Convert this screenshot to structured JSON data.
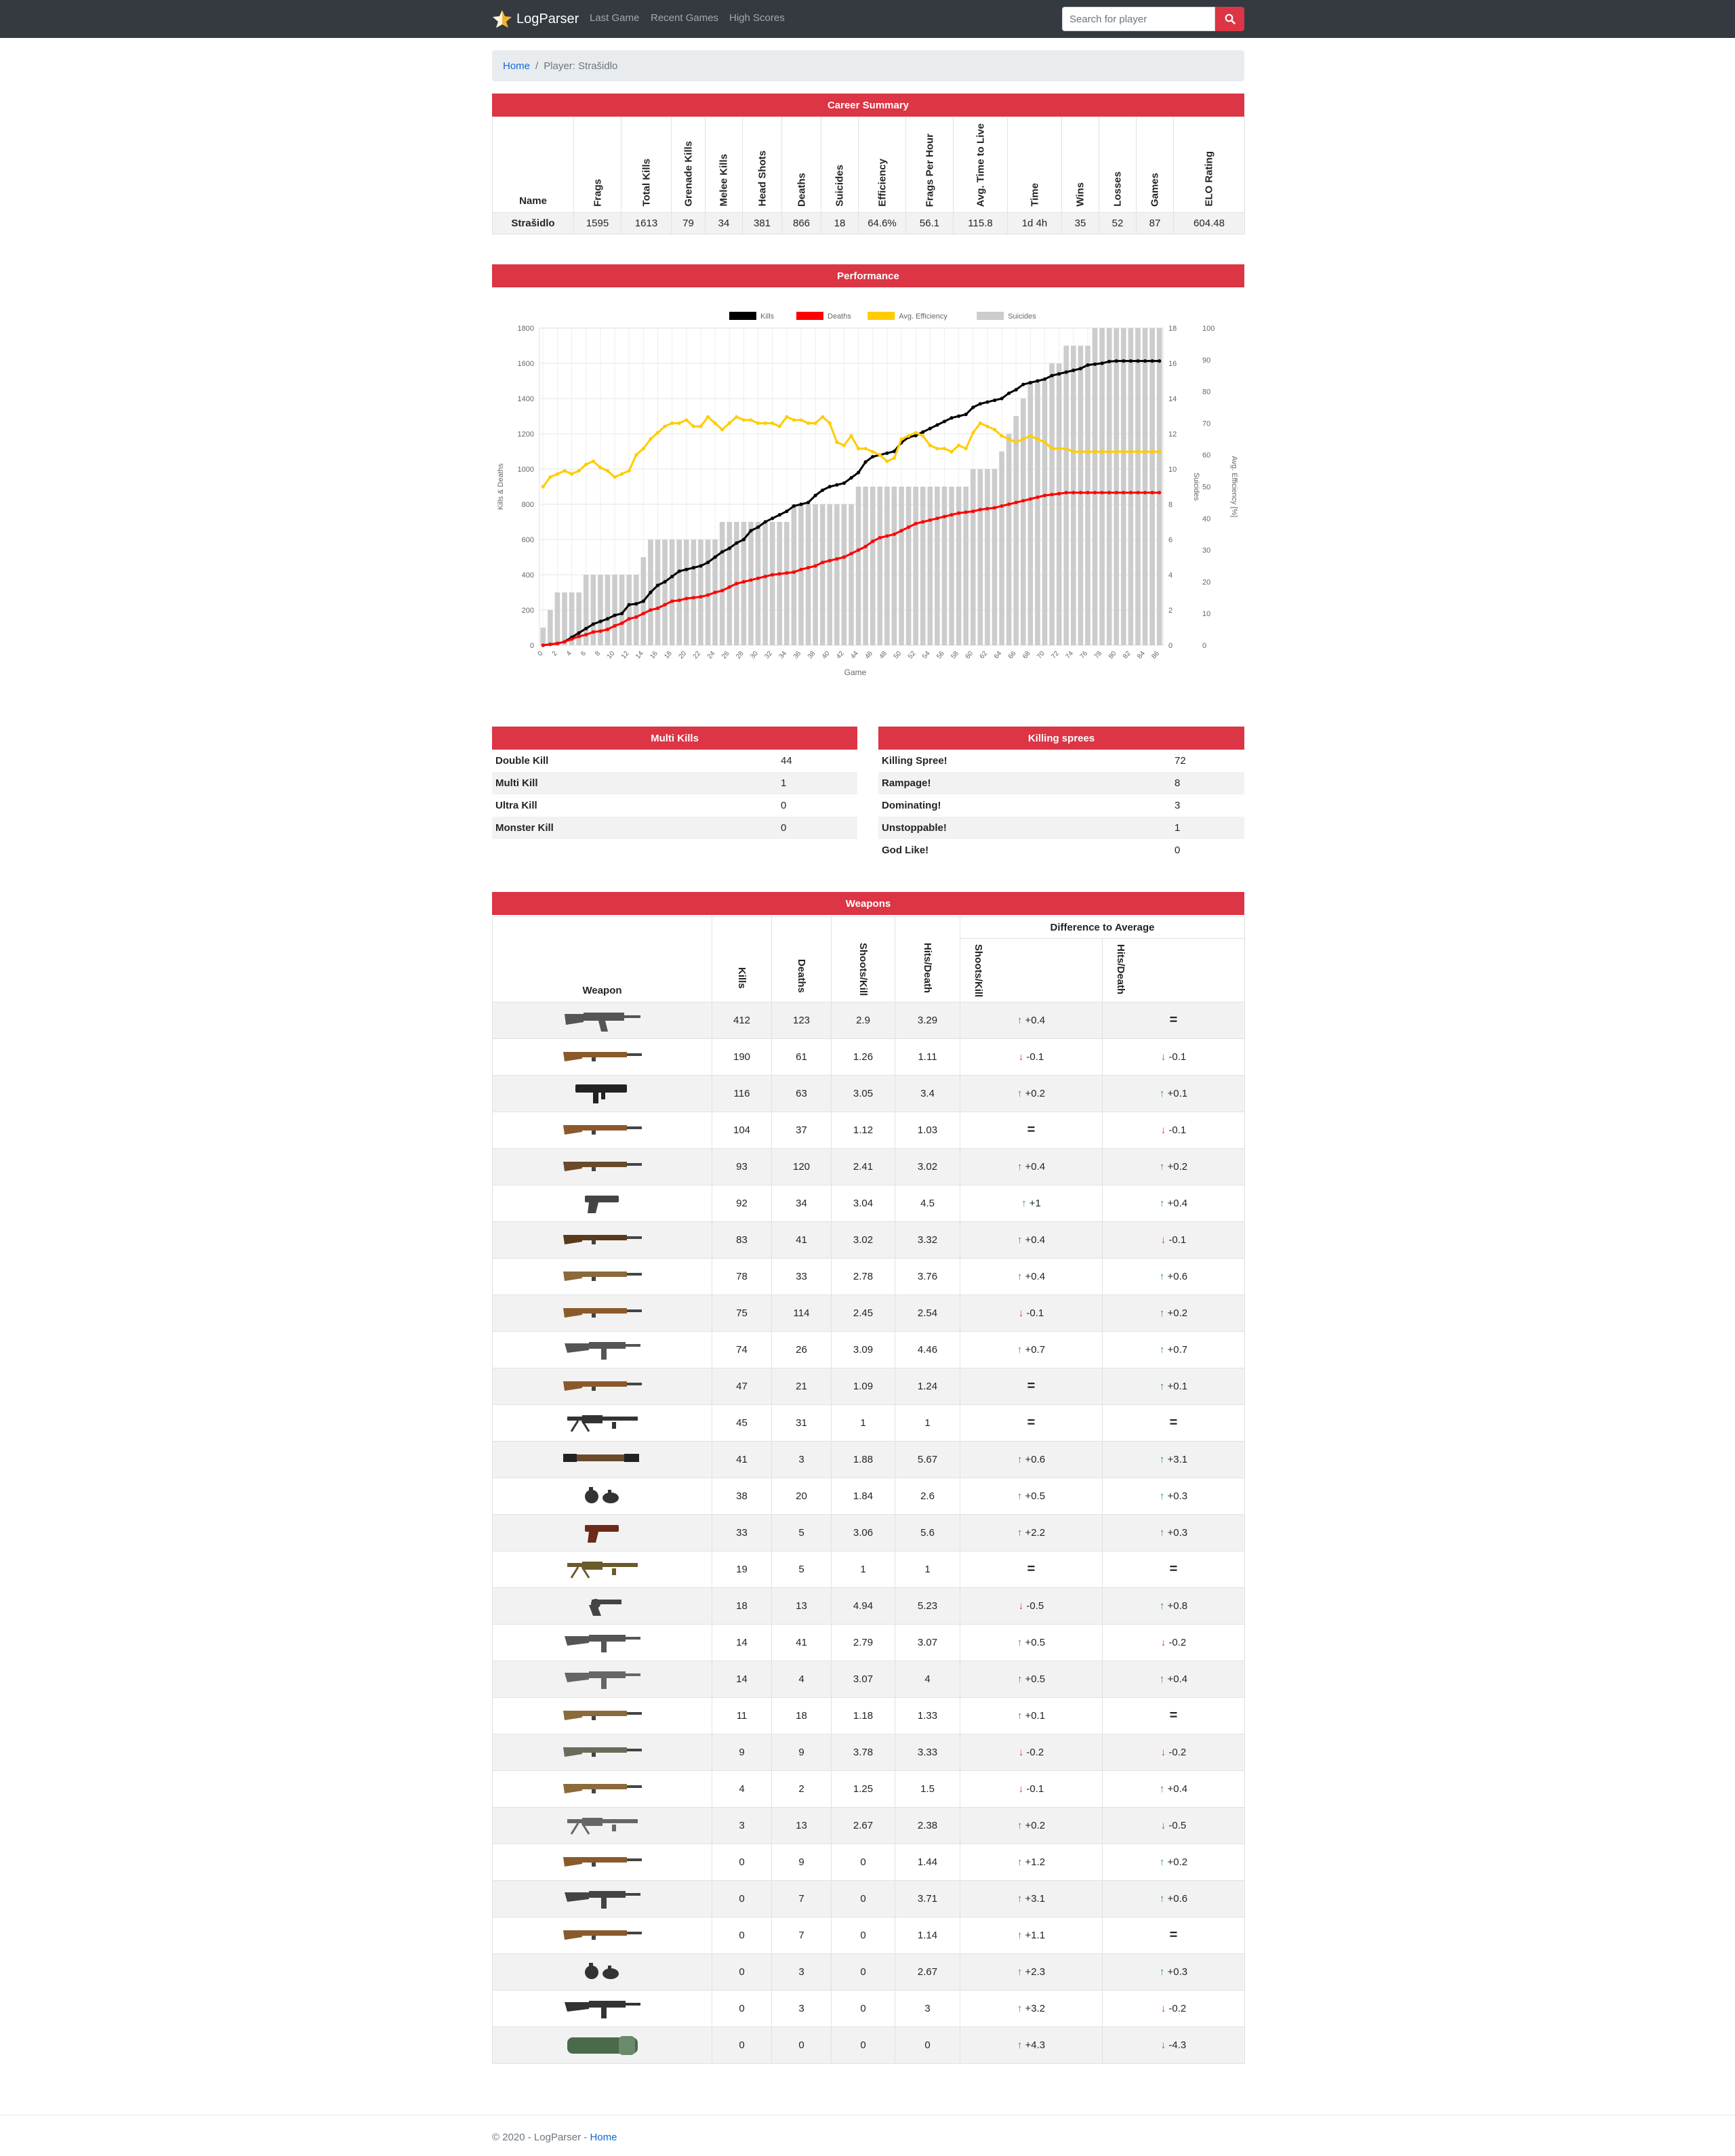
{
  "nav": {
    "brand": "LogParser",
    "links": [
      "Last Game",
      "Recent Games",
      "High Scores"
    ],
    "search_placeholder": "Search for player"
  },
  "breadcrumb": {
    "home": "Home",
    "current": "Player: Strašidlo"
  },
  "career": {
    "title": "Career Summary",
    "columns": [
      "Name",
      "Frags",
      "Total Kills",
      "Grenade Kills",
      "Melee Kills",
      "Head Shots",
      "Deaths",
      "Suicides",
      "Efficiency",
      "Frags Per Hour",
      "Avg. Time to Live",
      "Time",
      "Wins",
      "Losses",
      "Games",
      "ELO Rating"
    ],
    "row": [
      "Strašidlo",
      "1595",
      "1613",
      "79",
      "34",
      "381",
      "866",
      "18",
      "64.6%",
      "56.1",
      "115.8",
      "1d 4h",
      "35",
      "52",
      "87",
      "604.48"
    ]
  },
  "performance": {
    "title": "Performance"
  },
  "chart_data": {
    "type": "line",
    "xlabel": "Game",
    "ylabel": "Kills & Deaths",
    "y2label": "Suicides",
    "y3label": "Avg. Efficiency [%]",
    "ylim": [
      0,
      1800
    ],
    "y2lim": [
      0,
      18
    ],
    "y3lim": [
      0,
      100
    ],
    "yticks": [
      0,
      200,
      400,
      600,
      800,
      1000,
      1200,
      1400,
      1600,
      1800
    ],
    "y2ticks": [
      0,
      2,
      4,
      6,
      8,
      10,
      12,
      14,
      16,
      18
    ],
    "y3ticks": [
      0,
      10,
      20,
      30,
      40,
      50,
      60,
      70,
      80,
      90,
      100
    ],
    "xticks": [
      0,
      2,
      4,
      6,
      8,
      10,
      12,
      14,
      16,
      18,
      20,
      22,
      24,
      26,
      28,
      30,
      32,
      34,
      36,
      38,
      40,
      42,
      44,
      46,
      48,
      50,
      52,
      54,
      56,
      58,
      60,
      62,
      64,
      66,
      68,
      70,
      72,
      74,
      76,
      78,
      80,
      82,
      84,
      86
    ],
    "legend": "top",
    "series": [
      {
        "name": "Kills",
        "color": "#000000",
        "axis": "left",
        "values": [
          0,
          5,
          10,
          20,
          45,
          70,
          95,
          120,
          135,
          150,
          170,
          180,
          230,
          235,
          250,
          300,
          340,
          360,
          390,
          420,
          430,
          440,
          450,
          470,
          500,
          530,
          550,
          580,
          600,
          650,
          670,
          700,
          720,
          740,
          760,
          790,
          800,
          810,
          850,
          880,
          900,
          910,
          920,
          950,
          980,
          1040,
          1070,
          1080,
          1090,
          1100,
          1150,
          1180,
          1190,
          1210,
          1230,
          1250,
          1270,
          1290,
          1300,
          1310,
          1350,
          1370,
          1380,
          1390,
          1400,
          1430,
          1450,
          1480,
          1490,
          1500,
          1510,
          1530,
          1540,
          1550,
          1560,
          1570,
          1590,
          1595,
          1600,
          1610,
          1613,
          1613,
          1613,
          1613,
          1613,
          1613,
          1613
        ]
      },
      {
        "name": "Deaths",
        "color": "#ff0000",
        "axis": "left",
        "values": [
          0,
          5,
          10,
          20,
          35,
          50,
          60,
          75,
          80,
          90,
          110,
          125,
          150,
          160,
          180,
          200,
          210,
          230,
          250,
          255,
          265,
          270,
          275,
          285,
          300,
          310,
          330,
          350,
          360,
          370,
          380,
          390,
          400,
          405,
          410,
          415,
          430,
          440,
          450,
          470,
          480,
          490,
          500,
          520,
          540,
          560,
          590,
          610,
          620,
          630,
          650,
          670,
          690,
          700,
          710,
          720,
          730,
          740,
          750,
          755,
          760,
          770,
          775,
          780,
          790,
          800,
          810,
          820,
          830,
          840,
          850,
          855,
          860,
          866,
          866,
          866,
          866,
          866,
          866,
          866,
          866,
          866,
          866,
          866,
          866,
          866,
          866
        ]
      },
      {
        "name": "Avg. Efficiency",
        "color": "#ffcc00",
        "axis": "efficiency",
        "values": [
          50,
          53,
          54,
          55,
          54,
          55,
          57,
          58,
          56,
          55,
          53,
          54,
          55,
          60,
          62,
          65,
          67,
          69,
          70,
          70,
          71,
          69,
          69,
          72,
          70,
          68,
          70,
          72,
          71,
          71,
          70,
          70,
          70,
          69,
          72,
          71,
          71,
          70,
          70,
          72,
          70,
          64,
          63,
          66,
          62,
          62,
          61,
          60,
          58,
          59,
          65,
          66,
          67,
          66,
          63,
          62,
          62,
          61,
          63,
          62,
          67,
          70,
          69,
          68,
          66,
          65,
          64,
          65,
          66,
          65,
          64,
          62,
          62,
          62,
          61,
          61,
          61,
          61,
          61,
          61,
          61,
          61,
          61,
          61,
          61,
          61,
          61
        ]
      },
      {
        "name": "Suicides",
        "color": "#cccccc",
        "axis": "suicides",
        "values": [
          1,
          2,
          3,
          3,
          3,
          3,
          4,
          4,
          4,
          4,
          4,
          4,
          4,
          4,
          5,
          6,
          6,
          6,
          6,
          6,
          6,
          6,
          6,
          6,
          6,
          7,
          7,
          7,
          7,
          7,
          7,
          7,
          7,
          7,
          7,
          8,
          8,
          8,
          8,
          8,
          8,
          8,
          8,
          8,
          9,
          9,
          9,
          9,
          9,
          9,
          9,
          9,
          9,
          9,
          9,
          9,
          9,
          9,
          9,
          9,
          10,
          10,
          10,
          10,
          11,
          12,
          13,
          14,
          15,
          15,
          15,
          16,
          16,
          17,
          17,
          17,
          17,
          18,
          18,
          18,
          18,
          18,
          18,
          18,
          18,
          18,
          18
        ]
      }
    ]
  },
  "multi": {
    "title": "Multi Kills",
    "rows": [
      [
        "Double Kill",
        "44"
      ],
      [
        "Multi Kill",
        "1"
      ],
      [
        "Ultra Kill",
        "0"
      ],
      [
        "Monster Kill",
        "0"
      ]
    ]
  },
  "sprees": {
    "title": "Killing sprees",
    "rows": [
      [
        "Killing Spree!",
        "72"
      ],
      [
        "Rampage!",
        "8"
      ],
      [
        "Dominating!",
        "3"
      ],
      [
        "Unstoppable!",
        "1"
      ],
      [
        "God Like!",
        "0"
      ]
    ]
  },
  "weapons": {
    "title": "Weapons",
    "columns": {
      "weapon": "Weapon",
      "kills": "Kills",
      "deaths": "Deaths",
      "spk": "Shoots/Kill",
      "hpd": "Hits/Death",
      "diff": "Difference to Average",
      "dspk": "Shoots/Kill",
      "dhpd": "Hits/Death"
    },
    "rows": [
      {
        "icon": "mp44",
        "c": "#555555",
        "kills": "412",
        "deaths": "123",
        "spk": "2.9",
        "hpd": "3.29",
        "d1": "+0.4",
        "t1": "up",
        "d2": "",
        "t2": "eq"
      },
      {
        "icon": "carbine",
        "c": "#8b5a2b",
        "kills": "190",
        "deaths": "61",
        "spk": "1.26",
        "hpd": "1.11",
        "d1": "-0.1",
        "t1": "dn",
        "d2": "-0.1",
        "t2": "dn"
      },
      {
        "icon": "grease-gun",
        "c": "#222222",
        "kills": "116",
        "deaths": "63",
        "spk": "3.05",
        "hpd": "3.4",
        "d1": "+0.2",
        "t1": "up",
        "d2": "+0.1",
        "t2": "up"
      },
      {
        "icon": "rifle",
        "c": "#8b5a2b",
        "kills": "104",
        "deaths": "37",
        "spk": "1.12",
        "hpd": "1.03",
        "d1": "",
        "t1": "eq",
        "d2": "-0.1",
        "t2": "dn"
      },
      {
        "icon": "shotgun",
        "c": "#6b4a2b",
        "kills": "93",
        "deaths": "120",
        "spk": "2.41",
        "hpd": "3.02",
        "d1": "+0.4",
        "t1": "up",
        "d2": "+0.2",
        "t2": "up"
      },
      {
        "icon": "pistol",
        "c": "#444444",
        "kills": "92",
        "deaths": "34",
        "spk": "3.04",
        "hpd": "4.5",
        "d1": "+1",
        "t1": "up",
        "d2": "+0.4",
        "t2": "up"
      },
      {
        "icon": "rifle",
        "c": "#5a3a1a",
        "kills": "83",
        "deaths": "41",
        "spk": "3.02",
        "hpd": "3.32",
        "d1": "+0.4",
        "t1": "up",
        "d2": "-0.1",
        "t2": "dn"
      },
      {
        "icon": "rifle",
        "c": "#8b6a3b",
        "kills": "78",
        "deaths": "33",
        "spk": "2.78",
        "hpd": "3.76",
        "d1": "+0.4",
        "t1": "up",
        "d2": "+0.6",
        "t2": "up"
      },
      {
        "icon": "rifle",
        "c": "#8b5a2b",
        "kills": "75",
        "deaths": "114",
        "spk": "2.45",
        "hpd": "2.54",
        "d1": "-0.1",
        "t1": "dn",
        "d2": "+0.2",
        "t2": "up"
      },
      {
        "icon": "smg",
        "c": "#555555",
        "kills": "74",
        "deaths": "26",
        "spk": "3.09",
        "hpd": "4.46",
        "d1": "+0.7",
        "t1": "up",
        "d2": "+0.7",
        "t2": "up"
      },
      {
        "icon": "rifle",
        "c": "#8b5a2b",
        "kills": "47",
        "deaths": "21",
        "spk": "1.09",
        "hpd": "1.24",
        "d1": "",
        "t1": "eq",
        "d2": "+0.1",
        "t2": "up"
      },
      {
        "icon": "mg",
        "c": "#333333",
        "kills": "45",
        "deaths": "31",
        "spk": "1",
        "hpd": "1",
        "d1": "",
        "t1": "eq",
        "d2": "",
        "t2": "eq"
      },
      {
        "icon": "bazooka",
        "c": "#6b4a2b",
        "kills": "41",
        "deaths": "3",
        "spk": "1.88",
        "hpd": "5.67",
        "d1": "+0.6",
        "t1": "up",
        "d2": "+3.1",
        "t2": "up"
      },
      {
        "icon": "grenade",
        "c": "#333333",
        "kills": "38",
        "deaths": "20",
        "spk": "1.84",
        "hpd": "2.6",
        "d1": "+0.5",
        "t1": "up",
        "d2": "+0.3",
        "t2": "up"
      },
      {
        "icon": "pistol",
        "c": "#6b2a1a",
        "kills": "33",
        "deaths": "5",
        "spk": "3.06",
        "hpd": "5.6",
        "d1": "+2.2",
        "t1": "up",
        "d2": "+0.3",
        "t2": "up"
      },
      {
        "icon": "mg",
        "c": "#6b5a2b",
        "kills": "19",
        "deaths": "5",
        "spk": "1",
        "hpd": "1",
        "d1": "",
        "t1": "eq",
        "d2": "",
        "t2": "eq"
      },
      {
        "icon": "revolver",
        "c": "#444444",
        "kills": "18",
        "deaths": "13",
        "spk": "4.94",
        "hpd": "5.23",
        "d1": "-0.5",
        "t1": "dn",
        "d2": "+0.8",
        "t2": "up"
      },
      {
        "icon": "smg",
        "c": "#555555",
        "kills": "14",
        "deaths": "41",
        "spk": "2.79",
        "hpd": "3.07",
        "d1": "+0.5",
        "t1": "up",
        "d2": "-0.2",
        "t2": "dn"
      },
      {
        "icon": "smg",
        "c": "#666666",
        "kills": "14",
        "deaths": "4",
        "spk": "3.07",
        "hpd": "4",
        "d1": "+0.5",
        "t1": "up",
        "d2": "+0.4",
        "t2": "up"
      },
      {
        "icon": "rifle",
        "c": "#8b6a3b",
        "kills": "11",
        "deaths": "18",
        "spk": "1.18",
        "hpd": "1.33",
        "d1": "+0.1",
        "t1": "up",
        "d2": "",
        "t2": "eq"
      },
      {
        "icon": "rifle",
        "c": "#6b6b5b",
        "kills": "9",
        "deaths": "9",
        "spk": "3.78",
        "hpd": "3.33",
        "d1": "-0.2",
        "t1": "dn",
        "d2": "-0.2",
        "t2": "dn"
      },
      {
        "icon": "rifle",
        "c": "#8b6a3b",
        "kills": "4",
        "deaths": "2",
        "spk": "1.25",
        "hpd": "1.5",
        "d1": "-0.1",
        "t1": "dn",
        "d2": "+0.4",
        "t2": "up"
      },
      {
        "icon": "mg",
        "c": "#666666",
        "kills": "3",
        "deaths": "13",
        "spk": "2.67",
        "hpd": "2.38",
        "d1": "+0.2",
        "t1": "up",
        "d2": "-0.5",
        "t2": "dn"
      },
      {
        "icon": "rifle",
        "c": "#8b5a2b",
        "kills": "0",
        "deaths": "9",
        "spk": "0",
        "hpd": "1.44",
        "d1": "+1.2",
        "t1": "up",
        "d2": "+0.2",
        "t2": "up"
      },
      {
        "icon": "smg",
        "c": "#444444",
        "kills": "0",
        "deaths": "7",
        "spk": "0",
        "hpd": "3.71",
        "d1": "+3.1",
        "t1": "up",
        "d2": "+0.6",
        "t2": "up"
      },
      {
        "icon": "rifle",
        "c": "#8b5a2b",
        "kills": "0",
        "deaths": "7",
        "spk": "0",
        "hpd": "1.14",
        "d1": "+1.1",
        "t1": "up",
        "d2": "",
        "t2": "eq"
      },
      {
        "icon": "grenade",
        "c": "#333333",
        "kills": "0",
        "deaths": "3",
        "spk": "0",
        "hpd": "2.67",
        "d1": "+2.3",
        "t1": "up",
        "d2": "+0.3",
        "t2": "up"
      },
      {
        "icon": "smg",
        "c": "#333333",
        "kills": "0",
        "deaths": "3",
        "spk": "0",
        "hpd": "3",
        "d1": "+3.2",
        "t1": "up",
        "d2": "-0.2",
        "t2": "dn"
      },
      {
        "icon": "mine",
        "c": "#4a6a4a",
        "kills": "0",
        "deaths": "0",
        "spk": "0",
        "hpd": "0",
        "d1": "+4.3",
        "t1": "up",
        "d2": "-4.3",
        "t2": "dn"
      }
    ]
  },
  "footer": {
    "text": "© 2020 - LogParser - ",
    "link": "Home"
  }
}
